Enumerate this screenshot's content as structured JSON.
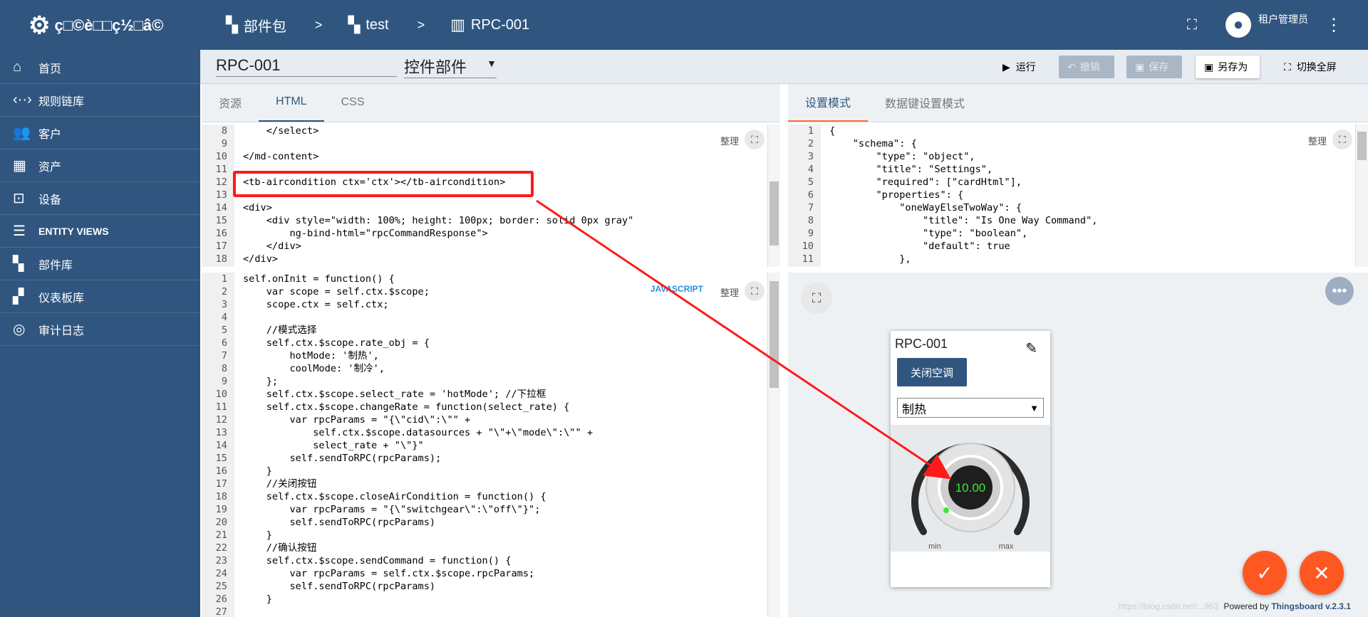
{
  "app": {
    "title": "ç□©è□□ç½□â©"
  },
  "sidebar": {
    "items": [
      {
        "label": "首页",
        "icon": "home-icon",
        "glyph": "⌂"
      },
      {
        "label": "规则链库",
        "icon": "rule-chain-icon",
        "glyph": "‹··›"
      },
      {
        "label": "客户",
        "icon": "customers-icon",
        "glyph": "👥"
      },
      {
        "label": "资产",
        "icon": "assets-icon",
        "glyph": "▦"
      },
      {
        "label": "设备",
        "icon": "devices-icon",
        "glyph": "⊡"
      },
      {
        "label": "ENTITY VIEWS",
        "icon": "entity-views-icon",
        "glyph": "☰"
      },
      {
        "label": "部件库",
        "icon": "widgets-library-icon",
        "glyph": "▚"
      },
      {
        "label": "仪表板库",
        "icon": "dashboards-icon",
        "glyph": "▞"
      },
      {
        "label": "审计日志",
        "icon": "audit-log-icon",
        "glyph": "◎"
      }
    ]
  },
  "breadcrumb": {
    "items": [
      "部件包",
      "test",
      "RPC-001"
    ],
    "separator": ">"
  },
  "user": {
    "label": "租户管理员"
  },
  "toolbar": {
    "name_value": "RPC-001",
    "type_value": "控件部件",
    "run": "运行",
    "undo": "撤销",
    "save": "保存",
    "save_as": "另存为",
    "fullscreen": "切换全屏"
  },
  "left_tabs": [
    "资源",
    "HTML",
    "CSS"
  ],
  "right_tabs": [
    "设置模式",
    "数据键设置模式"
  ],
  "tidy_label": "整理",
  "js_label": "JAVASCRIPT",
  "html_editor": {
    "gutter": "8\n9\n10\n11\n12\n13\n14\n15\n16\n17\n18",
    "lines": [
      "    </select>",
      "",
      "</md-content>",
      "",
      "<tb-aircondition ctx='ctx'></tb-aircondition>",
      "",
      "<div>",
      "    <div style=\"width: 100%; height: 100px; border: solid 0px gray\"",
      "        ng-bind-html=\"rpcCommandResponse\">",
      "    </div>",
      "</div>"
    ]
  },
  "settings_editor": {
    "gutter": "1\n2\n3\n4\n5\n6\n7\n8\n9\n10\n11",
    "lines": [
      "{",
      "    \"schema\": {",
      "        \"type\": \"object\",",
      "        \"title\": \"Settings\",",
      "        \"required\": [\"cardHtml\"],",
      "        \"properties\": {",
      "            \"oneWayElseTwoWay\": {",
      "                \"title\": \"Is One Way Command\",",
      "                \"type\": \"boolean\",",
      "                \"default\": true",
      "            },"
    ]
  },
  "js_editor": {
    "gutter": "1\n2\n3\n4\n5\n6\n7\n8\n9\n10\n11\n12\n13\n14\n15\n16\n17\n18\n19\n20\n21\n22\n23\n24\n25\n26\n27",
    "lines": [
      "self.onInit = function() {",
      "    var scope = self.ctx.$scope;",
      "    scope.ctx = self.ctx;",
      "",
      "    //模式选择",
      "    self.ctx.$scope.rate_obj = {",
      "        hotMode: '制热',",
      "        coolMode: '制冷',",
      "    };",
      "    self.ctx.$scope.select_rate = 'hotMode'; //下拉框",
      "    self.ctx.$scope.changeRate = function(select_rate) {",
      "        var rpcParams = \"{\\\"cid\\\":\\\"\" +",
      "            self.ctx.$scope.datasources + \"\\\"+\\\"mode\\\":\\\"\" +",
      "            select_rate + \"\\\"}\"",
      "        self.sendToRPC(rpcParams);",
      "    }",
      "    //关闭按钮",
      "    self.ctx.$scope.closeAirCondition = function() {",
      "        var rpcParams = \"{\\\"switchgear\\\":\\\"off\\\"}\";",
      "        self.sendToRPC(rpcParams)",
      "    }",
      "    //确认按钮",
      "    self.ctx.$scope.sendCommand = function() {",
      "        var rpcParams = self.ctx.$scope.rpcParams;",
      "        self.sendToRPC(rpcParams)",
      "    }",
      ""
    ]
  },
  "widget": {
    "title": "RPC-001",
    "close_button": "关闭空调",
    "mode_value": "制热",
    "knob_value": "10.00",
    "min_label": "min",
    "max_label": "max"
  },
  "footer": {
    "powered": "Powered by ",
    "brand": "Thingsboard v.2.3.1",
    "watermark": "https://blog.csdn.net/...963"
  },
  "colors": {
    "primary": "#305680",
    "accent": "#ff5722",
    "highlight": "#ff1a1a",
    "knob_value": "#37e836"
  }
}
